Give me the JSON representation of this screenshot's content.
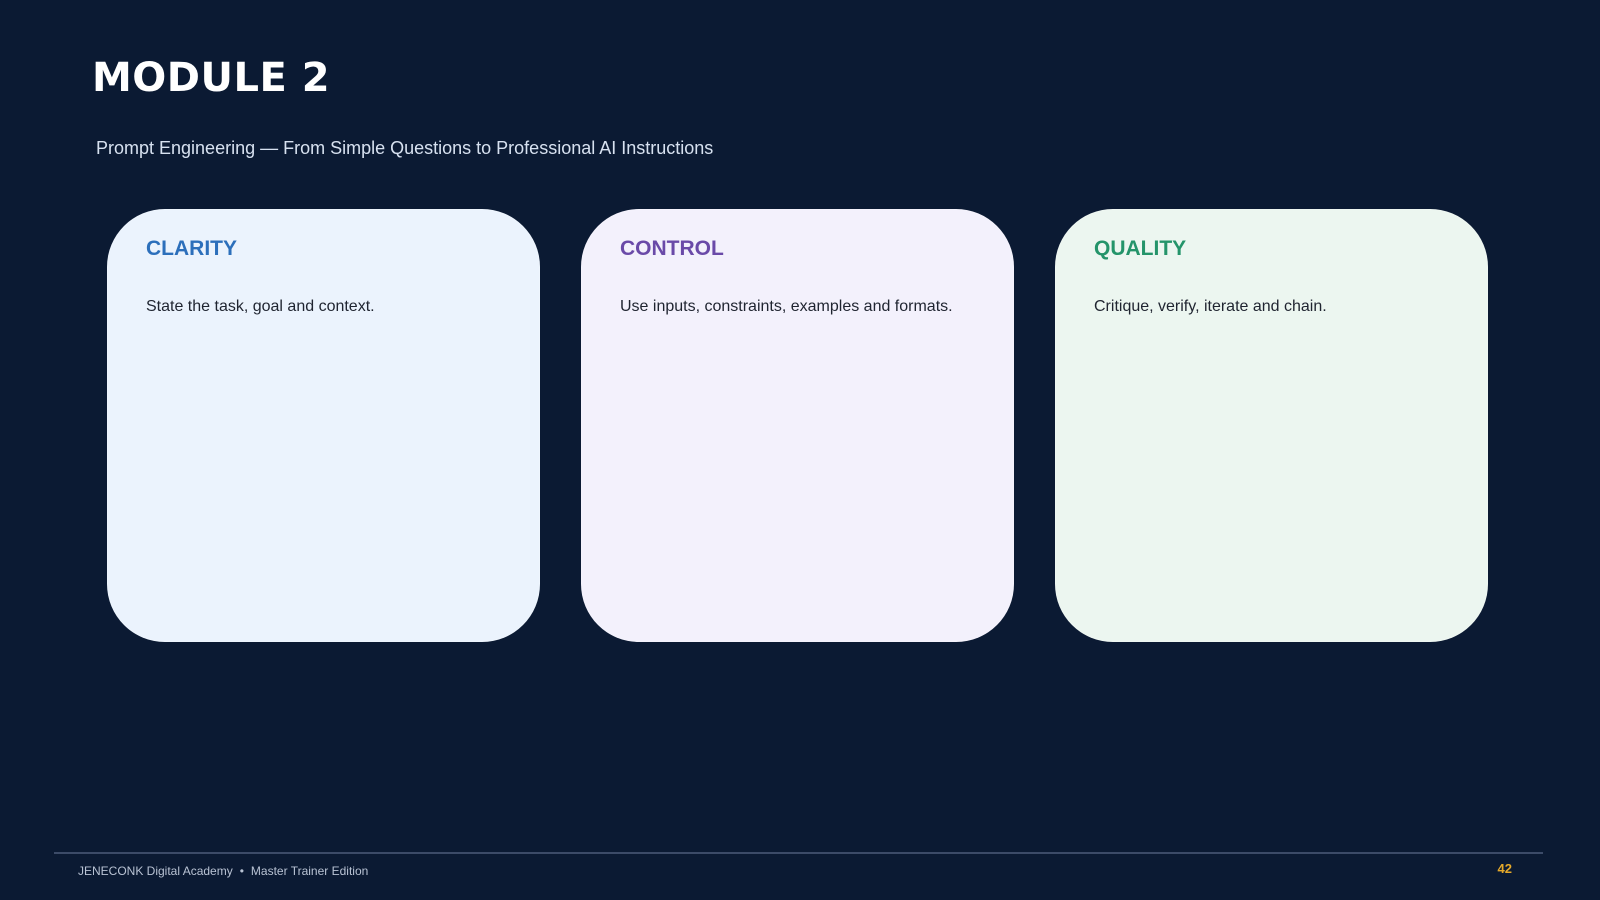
{
  "slide": {
    "title": "MODULE 2",
    "subtitle": "Prompt Engineering — From Simple Questions to Professional AI Instructions"
  },
  "cards": [
    {
      "heading": "CLARITY",
      "body": "State the task, goal and context.",
      "heading_color": "#2c6fbb",
      "background": "#ebf3fd"
    },
    {
      "heading": "CONTROL",
      "body": "Use inputs, constraints, examples and formats.",
      "heading_color": "#6a4aa8",
      "background": "#f3f1fc"
    },
    {
      "heading": "QUALITY",
      "body": "Critique, verify, iterate and chain.",
      "heading_color": "#24946a",
      "background": "#ecf6f0"
    }
  ],
  "footer": {
    "organization": "JENECONK Digital Academy",
    "separator": "•",
    "edition": "Master Trainer Edition",
    "page_number": "42"
  },
  "colors": {
    "background": "#0b1a33",
    "accent": "#e6a92a"
  }
}
